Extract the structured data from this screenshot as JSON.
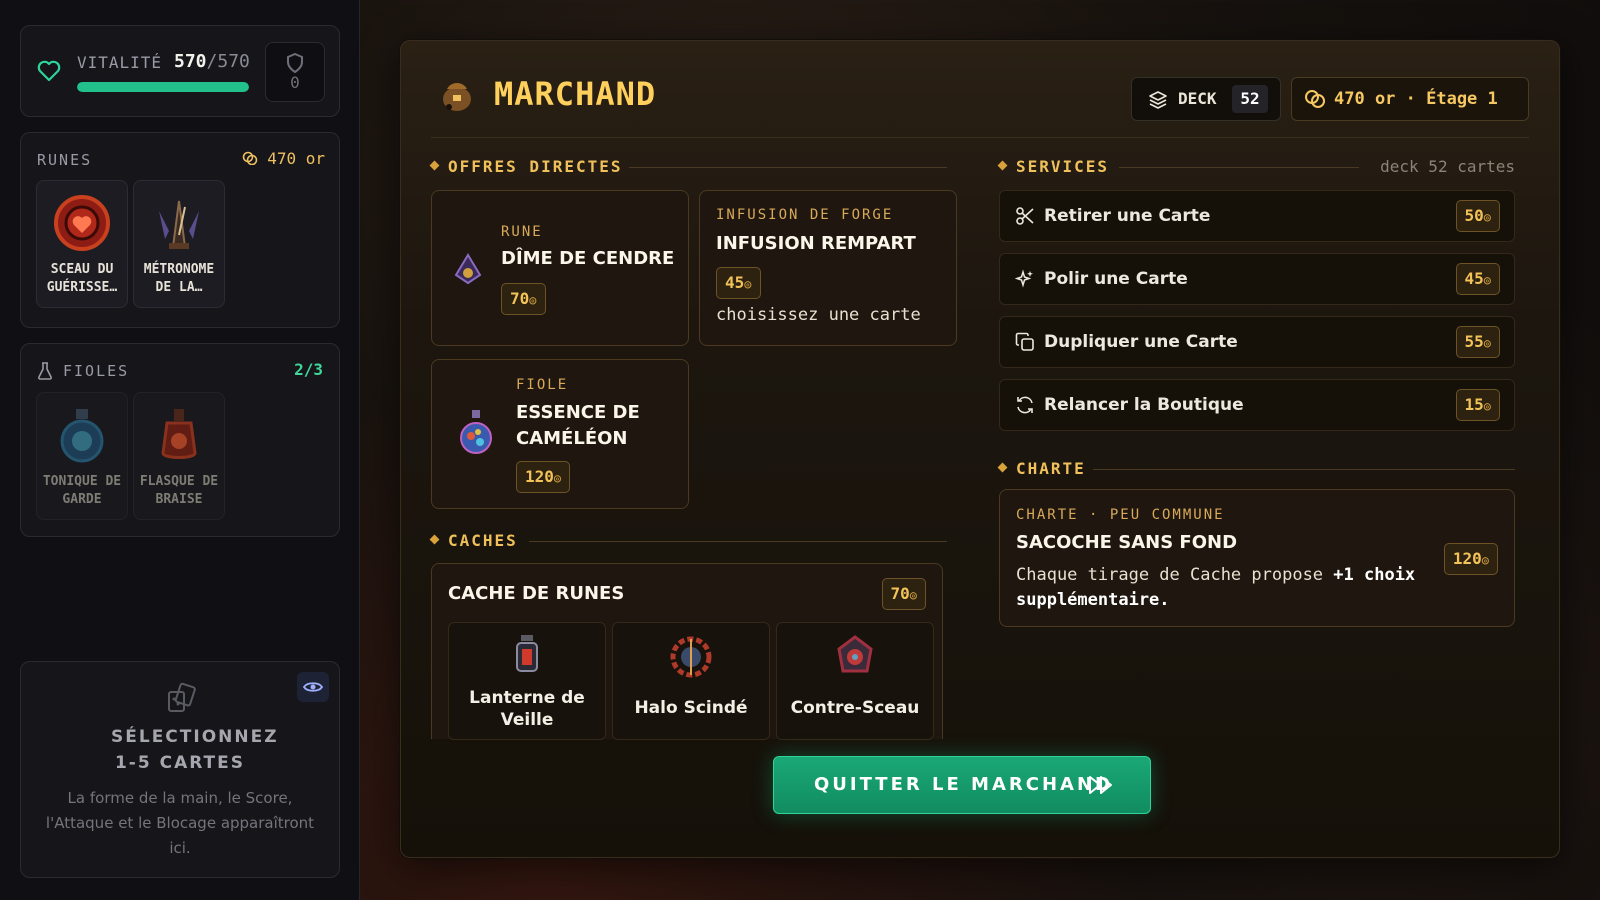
{
  "vitality": {
    "label": "VITALITÉ",
    "current": "570",
    "max": "/570",
    "fraction": 1.0,
    "block": "0"
  },
  "runes": {
    "title": "RUNES",
    "gold": "470 or",
    "items": [
      {
        "name": "SCEAU DU GUÉRISSE…",
        "icon": "red-seal-icon"
      },
      {
        "name": "MÉTRONOME DE LA…",
        "icon": "metronome-icon"
      }
    ]
  },
  "fioles": {
    "title": "FIOLES",
    "count": "2/3",
    "items": [
      {
        "name": "TONIQUE DE GARDE",
        "icon": "blue-flask-icon"
      },
      {
        "name": "FLASQUE DE BRAISE",
        "icon": "red-flask-icon"
      }
    ]
  },
  "selection": {
    "title": "SÉLECTIONNEZ 1-5 CARTES",
    "description": "La forme de la main, le Score, l'Attaque et le Blocage apparaîtront ici."
  },
  "merchant": {
    "title": "MARCHAND",
    "deck_label": "DECK",
    "deck_count": "52",
    "gold_floor": "470 or · Étage 1",
    "sections": {
      "offers": "OFFRES DIRECTES",
      "services": "SERVICES",
      "services_note": "deck 52 cartes",
      "caches": "CACHES",
      "charter": "CHARTE"
    },
    "offers": [
      {
        "category": "RUNE",
        "name": "DÎME DE CENDRE",
        "price": "70"
      },
      {
        "category": "INFUSION DE FORGE",
        "name": "INFUSION REMPART",
        "price": "45",
        "note": "choisissez une carte"
      },
      {
        "category": "FIOLE",
        "name": "ESSENCE DE CAMÉLÉON",
        "price": "120"
      }
    ],
    "services": [
      {
        "label": "Retirer une Carte",
        "price": "50",
        "icon": "scissors-icon"
      },
      {
        "label": "Polir une Carte",
        "price": "45",
        "icon": "sparkles-icon"
      },
      {
        "label": "Dupliquer une Carte",
        "price": "55",
        "icon": "copy-icon"
      },
      {
        "label": "Relancer la Boutique",
        "price": "15",
        "icon": "refresh-icon"
      }
    ],
    "cache": {
      "name": "CACHE DE RUNES",
      "price": "70",
      "items": [
        "Lanterne de Veille",
        "Halo Scindé",
        "Contre-Sceau"
      ]
    },
    "charter": {
      "category": "CHARTE · PEU COMMUNE",
      "name": "SACOCHE SANS FOND",
      "desc_prefix": "Chaque tirage de Cache propose ",
      "desc_bold": "+1 choix supplémentaire.",
      "price": "120"
    },
    "quit_label": "QUITTER LE MARCHAND"
  },
  "colors": {
    "accent_gold": "#ffd15c",
    "accent_green": "#22c08a",
    "panel_brown": "#1f170f"
  }
}
